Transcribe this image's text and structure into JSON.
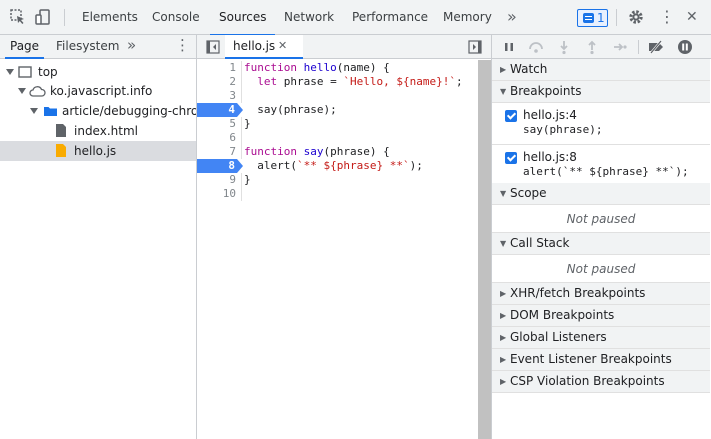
{
  "toolbar": {
    "tabs": [
      {
        "label": "Elements"
      },
      {
        "label": "Console"
      },
      {
        "label": "Sources"
      },
      {
        "label": "Network"
      },
      {
        "label": "Performance"
      },
      {
        "label": "Memory"
      }
    ],
    "more": "»",
    "issues_count": "1",
    "close": "✕",
    "menu": "⋮"
  },
  "navigator": {
    "tabs": [
      {
        "label": "Page"
      },
      {
        "label": "Filesystem"
      }
    ],
    "more": "»",
    "menu": "⋮",
    "tree": [
      {
        "label": "top"
      },
      {
        "label": "ko.javascript.info"
      },
      {
        "label": "article/debugging-chrom"
      },
      {
        "label": "index.html"
      },
      {
        "label": "hello.js"
      }
    ]
  },
  "editor": {
    "file_tab": "hello.js",
    "close": "✕",
    "lines": [
      {
        "num": "1",
        "code": "function hello(name) {"
      },
      {
        "num": "2",
        "code": "  let phrase = `Hello, ${name}!`;"
      },
      {
        "num": "3",
        "code": ""
      },
      {
        "num": "4",
        "code": "  say(phrase);"
      },
      {
        "num": "5",
        "code": "}"
      },
      {
        "num": "6",
        "code": ""
      },
      {
        "num": "7",
        "code": "function say(phrase) {"
      },
      {
        "num": "8",
        "code": "  alert(`** ${phrase} **`);"
      },
      {
        "num": "9",
        "code": "}"
      },
      {
        "num": "10",
        "code": ""
      }
    ]
  },
  "debugger": {
    "sections": {
      "watch": "Watch",
      "breakpoints": "Breakpoints",
      "scope": "Scope",
      "call_stack": "Call Stack",
      "xhr": "XHR/fetch Breakpoints",
      "dom": "DOM Breakpoints",
      "global": "Global Listeners",
      "event": "Event Listener Breakpoints",
      "csp": "CSP Violation Breakpoints"
    },
    "breakpoints": [
      {
        "location": "hello.js:4",
        "code": "say(phrase);"
      },
      {
        "location": "hello.js:8",
        "code": "alert(`** ${phrase} **`);"
      }
    ],
    "scope_status": "Not paused",
    "call_stack_status": "Not paused",
    "arrow_collapsed": "▶",
    "arrow_expanded": "▼"
  },
  "colors": {
    "accent": "#1a73e8",
    "breakpoint": "#4285f4",
    "toolbar_bg": "#f1f3f4"
  }
}
